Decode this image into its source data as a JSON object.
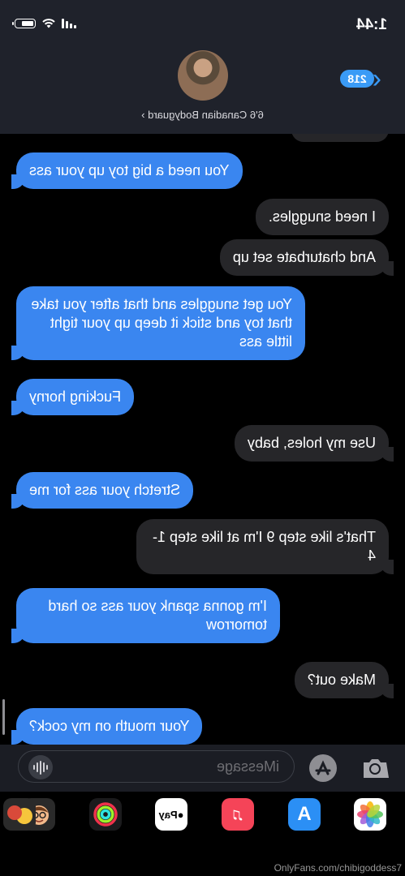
{
  "status": {
    "time": "1:44"
  },
  "header": {
    "back_count": "218",
    "contact_name": "6'6 Canadian Bodyguard"
  },
  "messages": [
    {
      "from": "them",
      "text": "You need a big toy up your ass"
    },
    {
      "from": "me",
      "text": "I need snuggles."
    },
    {
      "from": "me",
      "text": "And chaturbate set up"
    },
    {
      "from": "them",
      "text": "You get snuggles and that after you take that toy and stick it deep up your tight little ass"
    },
    {
      "from": "them",
      "text": "Fucking horny"
    },
    {
      "from": "me",
      "text": "Use my holes, baby"
    },
    {
      "from": "them",
      "text": "Stretch your ass for me"
    },
    {
      "from": "me",
      "text": "That's like step 9 I'm at like step 1-4"
    },
    {
      "from": "them",
      "text": "I'm gonna spank your ass so hard tomorrow"
    },
    {
      "from": "me",
      "text": "Make out?"
    },
    {
      "from": "them",
      "text": "Your mouth on my cock?"
    }
  ],
  "input": {
    "placeholder": "iMessage"
  },
  "apps": {
    "photos": "photos-app-icon",
    "appstore": "A",
    "music": "♫",
    "pay": "Pay",
    "activity": "activity-app-icon",
    "memoji": "memoji-app-icon"
  },
  "watermark": "OnlyFans.com/chibigoddess7"
}
